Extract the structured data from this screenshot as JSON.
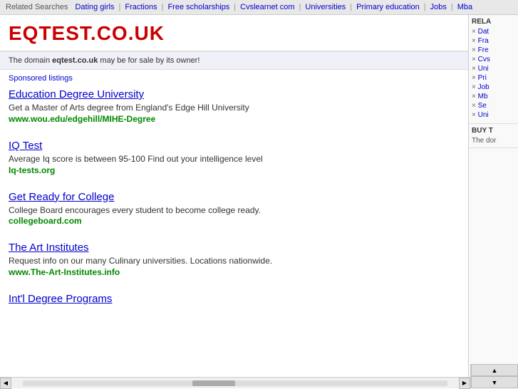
{
  "relatedBar": {
    "label": "Related Searches",
    "links": [
      "Dating girls",
      "Fractions",
      "Free scholarships",
      "Cvslearnet com",
      "Universities",
      "Primary education",
      "Jobs",
      "Mba"
    ]
  },
  "siteTitle": "EQTEST.CO.UK",
  "domainNotice": {
    "pre": "The domain ",
    "domain": "eqtest.co.uk",
    "post": " may be for sale by its owner!"
  },
  "sponsoredLabel": "Sponsored listings",
  "ads": [
    {
      "title": "Education Degree University",
      "desc": "Get a Master of Arts degree from England's Edge Hill University",
      "url": "www.wou.edu/edgehill/MIHE-Degree"
    },
    {
      "title": "IQ Test",
      "desc": "Average Iq score is between 95-100 Find out your intelligence level",
      "url": "Iq-tests.org"
    },
    {
      "title": "Get Ready for College",
      "desc": "College Board encourages every student to become college ready.",
      "url": "collegeboard.com"
    },
    {
      "title": "The Art Institutes",
      "desc": "Request info on our many Culinary universities. Locations nationwide.",
      "url": "www.The-Art-Institutes.info"
    },
    {
      "title": "Int'l Degree Programs",
      "desc": "",
      "url": ""
    }
  ],
  "sidebar": {
    "relaTitle": "RELA",
    "links": [
      "Dat",
      "Fra",
      "Fre",
      "Cvs",
      "Uni",
      "Pri",
      "Job",
      "Mb",
      "Se",
      "Uni"
    ],
    "buyTitle": "BUY T",
    "buyText": "The dor"
  }
}
